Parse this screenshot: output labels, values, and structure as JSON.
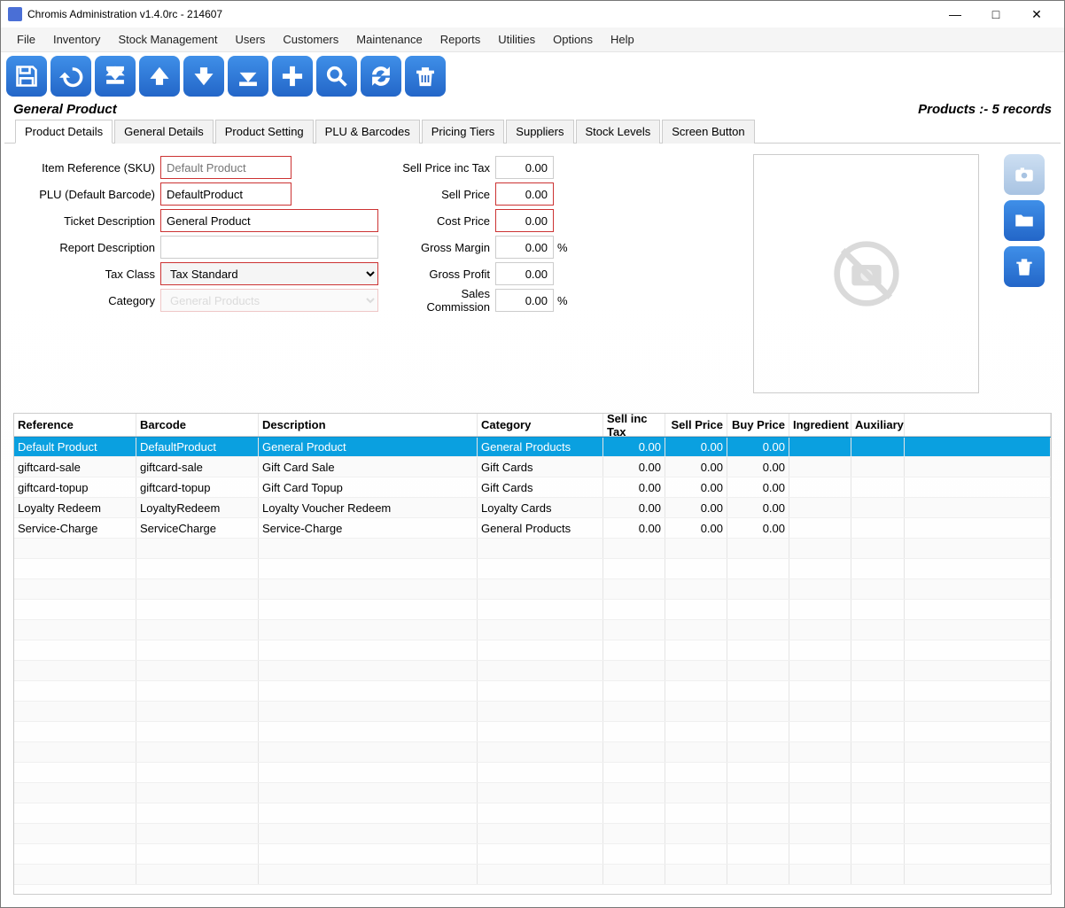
{
  "window": {
    "title": "Chromis Administration v1.4.0rc - 214607"
  },
  "menu": [
    "File",
    "Inventory",
    "Stock Management",
    "Users",
    "Customers",
    "Maintenance",
    "Reports",
    "Utilities",
    "Options",
    "Help"
  ],
  "header": {
    "title": "General Product",
    "count_label": "Products :- 5 records"
  },
  "tabs": [
    "Product Details",
    "General Details",
    "Product Setting",
    "PLU & Barcodes",
    "Pricing Tiers",
    "Suppliers",
    "Stock Levels",
    "Screen Button"
  ],
  "form": {
    "labels": {
      "sku": "Item Reference (SKU)",
      "plu": "PLU (Default Barcode)",
      "ticket": "Ticket Description",
      "report": "Report Description",
      "tax": "Tax Class",
      "category": "Category",
      "sell_inc": "Sell Price inc Tax",
      "sell": "Sell Price",
      "cost": "Cost Price",
      "margin": "Gross Margin",
      "profit": "Gross Profit",
      "commission": "Sales Commission"
    },
    "values": {
      "sku_placeholder": "Default Product",
      "plu": "DefaultProduct",
      "ticket": "General Product",
      "report": "",
      "tax": "Tax Standard",
      "category_placeholder": "General Products",
      "sell_inc": "0.00",
      "sell": "0.00",
      "cost": "0.00",
      "margin": "0.00",
      "profit": "0.00",
      "commission": "0.00",
      "pct": "%"
    }
  },
  "grid": {
    "columns": [
      "Reference",
      "Barcode",
      "Description",
      "Category",
      "Sell inc Tax",
      "Sell Price",
      "Buy Price",
      "Ingredient",
      "Auxiliary"
    ],
    "rows": [
      {
        "ref": "Default Product",
        "bar": "DefaultProduct",
        "desc": "General Product",
        "cat": "General Products",
        "sit": "0.00",
        "sp": "0.00",
        "bp": "0.00",
        "selected": true
      },
      {
        "ref": "giftcard-sale",
        "bar": "giftcard-sale",
        "desc": "Gift Card Sale",
        "cat": "Gift Cards",
        "sit": "0.00",
        "sp": "0.00",
        "bp": "0.00"
      },
      {
        "ref": "giftcard-topup",
        "bar": "giftcard-topup",
        "desc": "Gift Card Topup",
        "cat": "Gift Cards",
        "sit": "0.00",
        "sp": "0.00",
        "bp": "0.00"
      },
      {
        "ref": "Loyalty Redeem",
        "bar": "LoyaltyRedeem",
        "desc": "Loyalty Voucher Redeem",
        "cat": "Loyalty Cards",
        "sit": "0.00",
        "sp": "0.00",
        "bp": "0.00"
      },
      {
        "ref": "Service-Charge",
        "bar": "ServiceCharge",
        "desc": "Service-Charge",
        "cat": "General Products",
        "sit": "0.00",
        "sp": "0.00",
        "bp": "0.00"
      }
    ]
  }
}
